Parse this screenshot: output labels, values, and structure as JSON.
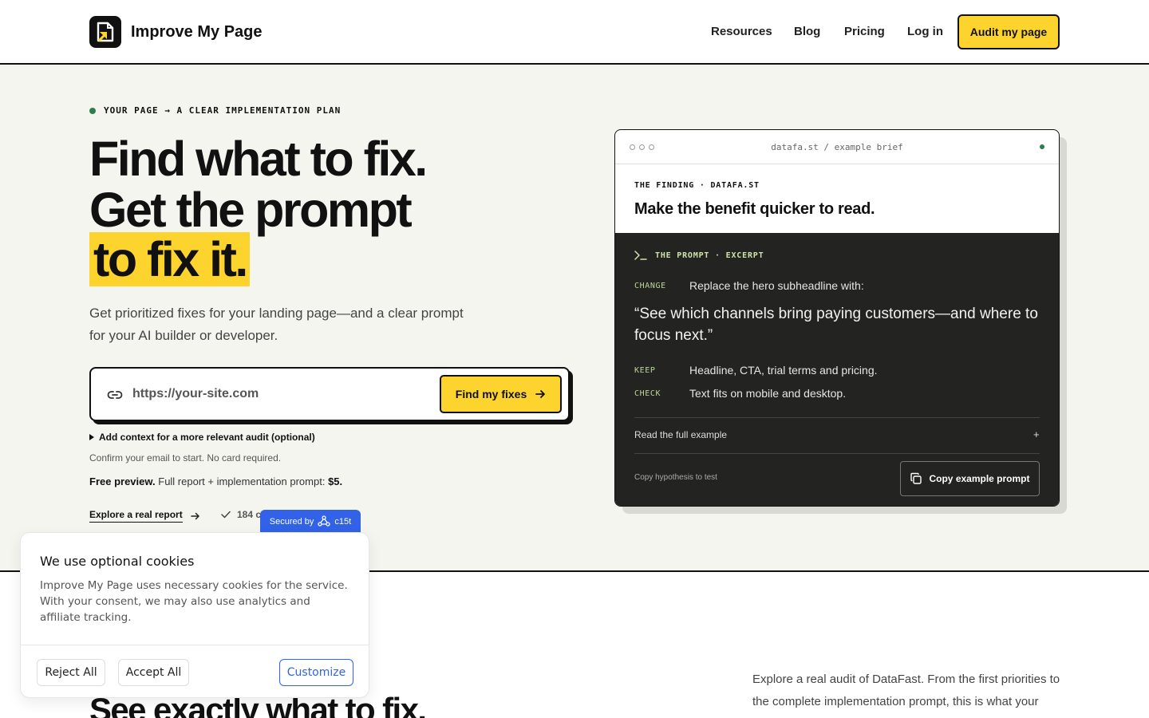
{
  "header": {
    "brand": "Improve My Page",
    "nav": [
      "Resources",
      "Blog",
      "Pricing",
      "Log in"
    ],
    "cta": "Audit my page"
  },
  "hero": {
    "eyebrow": "YOUR PAGE → A CLEAR IMPLEMENTATION PLAN",
    "headline_line1": "Find what to fix.",
    "headline_line2": "Get the prompt",
    "headline_line3": "to fix it.",
    "subheadline": "Get prioritized fixes for your landing page—and a clear prompt for your AI builder or developer.",
    "url_placeholder": "https://your-site.com",
    "find_button": "Find my fixes",
    "context_toggle": "Add context for a more relevant audit (optional)",
    "confirm_note": "Confirm your email to start. No card required.",
    "preview_label": "Free preview.",
    "preview_text": "Full report + implementation prompt:",
    "preview_price": "$5.",
    "explore_link": "Explore a real report",
    "reviews": "184 c",
    "secured_label": "Secured by",
    "secured_brand": "c15t"
  },
  "example_card": {
    "url_label": "datafa.st / example brief",
    "finding_label": "THE FINDING · DATAFA.ST",
    "finding_title": "Make the benefit quicker to read.",
    "prompt_label": "THE PROMPT · EXCERPT",
    "change_key": "CHANGE",
    "change_val": "Replace the hero subheadline with:",
    "quote": "“See which channels bring paying customers—and where to focus next.”",
    "keep_key": "KEEP",
    "keep_val": "Headline, CTA, trial terms and pricing.",
    "check_key": "CHECK",
    "check_val": "Text fits on mobile and desktop.",
    "read_full": "Read the full example",
    "expand_symbol": "+",
    "copy_hypothesis": "Copy hypothesis to test",
    "copy_button": "Copy example prompt"
  },
  "lower": {
    "headline": "See exactly what to fix.",
    "paragraph": "Explore a real audit of DataFast. From the first priorities to the complete implementation prompt, this is what your"
  },
  "cookie": {
    "title": "We use optional cookies",
    "text": "Improve My Page uses necessary cookies for the service. With your consent, we may also use analytics and affiliate tracking.",
    "reject": "Reject All",
    "accept": "Accept All",
    "customize": "Customize"
  },
  "colors": {
    "accent": "#fdd42d",
    "ink": "#111111",
    "hero_bg": "#f5f5f0",
    "dark_panel": "#232322",
    "secure_blue": "#3162e8",
    "status_green": "#2e7d4f"
  }
}
